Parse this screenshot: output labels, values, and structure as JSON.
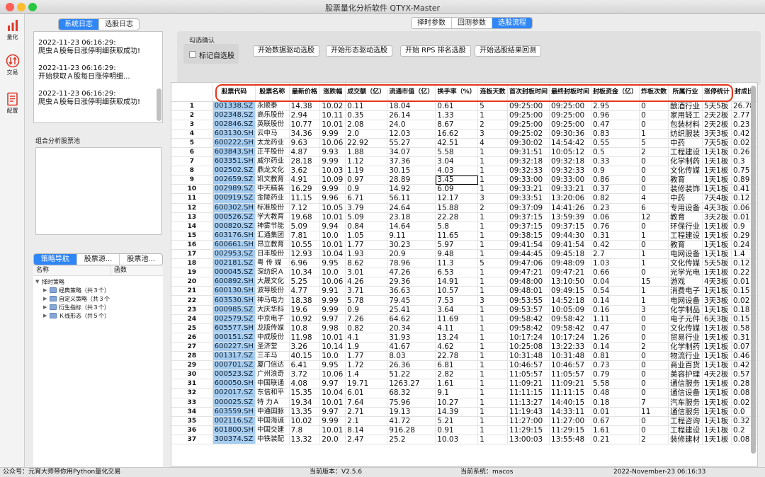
{
  "window": {
    "title": "股票量化分析软件 QTYX-Master",
    "controls": {
      "close": "#fd5f57",
      "minimize": "#febc2e",
      "maximize": "#27c840"
    }
  },
  "leftbar": {
    "items": [
      {
        "label": "量化",
        "icon": "bar-chart-icon",
        "color": "#e03a2a"
      },
      {
        "label": "交易",
        "icon": "trade-exchange-icon",
        "color": "#e03a2a"
      },
      {
        "label": "配置",
        "icon": "document-config-icon",
        "color": "#e03a2a"
      }
    ]
  },
  "log_tabs": [
    {
      "label": "系统日志",
      "active": true
    },
    {
      "label": "选股日志",
      "active": false
    }
  ],
  "log_entries": [
    {
      "time": "2022-11-23 06:16:29:",
      "msg": "爬虫Ａ股每日涨停明细获取成功!"
    },
    {
      "time": "2022-11-23 06:16:29:",
      "msg": "开始获取Ａ股每日涨停明细..."
    },
    {
      "time": "2022-11-23 06:16:29:",
      "msg": "爬虫Ａ股每日涨停明细获取成功!"
    }
  ],
  "pool": {
    "label": "组合分析股票池"
  },
  "nav_tabs": [
    {
      "label": "策略导航",
      "active": true
    },
    {
      "label": "股票源...",
      "active": false
    },
    {
      "label": "股票池...",
      "active": false
    }
  ],
  "tree": {
    "headers": [
      "名称",
      "函数"
    ],
    "root": "择时策略",
    "children": [
      "经典策略（共３个）",
      "自定义策略（共３个",
      "衍生指标（共３个）",
      "Ｋ线形态（共５个）"
    ]
  },
  "top_tabs": [
    {
      "label": "择时参数",
      "active": false
    },
    {
      "label": "回测参数",
      "active": false
    },
    {
      "label": "选股流程",
      "active": true
    }
  ],
  "select_group": {
    "label": "勾选确认",
    "checkbox_label": "标记自选股",
    "buttons": [
      "开始数据驱动选股",
      "开始形态驱动选股",
      "开始 RPS 排名选股",
      "开始选股结果回测"
    ]
  },
  "table": {
    "headers": [
      "股票代码",
      "股票名称",
      "最新价格",
      "涨跌幅",
      "成交额（亿）",
      "流通市值（亿）",
      "换手率（%）",
      "连板天数",
      "首次封板时间",
      "最终封板时间",
      "封板资金（亿）",
      "炸板次数",
      "所属行业",
      "涨停统计",
      "封成比"
    ],
    "rows": [
      [
        "1",
        "001338.SZ",
        "永顺泰",
        "14.38",
        "10.02",
        "0.11",
        "18.04",
        "0.61",
        "5",
        "09:25:00",
        "09:25:00",
        "2.95",
        "0",
        "酿酒行业",
        "5天5板",
        "26.78"
      ],
      [
        "2",
        "002348.SZ",
        "高乐股份",
        "2.94",
        "10.11",
        "0.35",
        "26.14",
        "1.33",
        "1",
        "09:25:00",
        "09:25:00",
        "0.96",
        "0",
        "家用轻工",
        "2天2板",
        "2.77"
      ],
      [
        "3",
        "002846.SZ",
        "英联股份",
        "10.77",
        "10.01",
        "2.08",
        "24.0",
        "8.67",
        "2",
        "09:25:00",
        "09:25:00",
        "0.47",
        "0",
        "包装材料",
        "2天2板",
        "0.23"
      ],
      [
        "4",
        "603130.SH",
        "云中马",
        "34.36",
        "9.99",
        "2.0",
        "12.03",
        "16.62",
        "3",
        "09:25:02",
        "09:30:36",
        "0.83",
        "1",
        "纺织服装",
        "3天3板",
        "0.42"
      ],
      [
        "5",
        "600222.SH",
        "太龙药业",
        "9.63",
        "10.06",
        "22.92",
        "55.27",
        "42.51",
        "4",
        "09:30:02",
        "14:54:42",
        "0.55",
        "5",
        "中药",
        "7天5板",
        "0.02"
      ],
      [
        "6",
        "603843.SH",
        "正平股份",
        "4.87",
        "9.93",
        "1.88",
        "34.07",
        "5.58",
        "1",
        "09:31:51",
        "10:05:12",
        "0.5",
        "2",
        "工程建设",
        "1天1板",
        "0.26"
      ],
      [
        "7",
        "603351.SH",
        "威尔药业",
        "28.18",
        "9.99",
        "1.12",
        "37.36",
        "3.04",
        "1",
        "09:32:18",
        "09:32:18",
        "0.33",
        "0",
        "化学制药",
        "1天1板",
        "0.3"
      ],
      [
        "8",
        "002502.SZ",
        "鼎龙文化",
        "3.62",
        "10.03",
        "1.19",
        "30.15",
        "4.03",
        "1",
        "09:32:33",
        "09:32:33",
        "0.9",
        "0",
        "文化传媒",
        "1天1板",
        "0.75"
      ],
      [
        "9",
        "002659.SZ",
        "凯文教育",
        "4.91",
        "10.09",
        "0.97",
        "28.89",
        "3.45",
        "1",
        "09:33:00",
        "09:33:00",
        "0.86",
        "0",
        "教育",
        "1天1板",
        "0.89"
      ],
      [
        "10",
        "002989.SZ",
        "中天精装",
        "16.29",
        "9.99",
        "0.9",
        "14.92",
        "6.09",
        "1",
        "09:33:21",
        "09:33:21",
        "0.37",
        "0",
        "装修装饰",
        "1天1板",
        "0.41"
      ],
      [
        "11",
        "000919.SZ",
        "金陵药业",
        "11.15",
        "9.96",
        "6.71",
        "56.11",
        "12.17",
        "3",
        "09:33:51",
        "13:20:06",
        "0.82",
        "4",
        "中药",
        "7天4板",
        "0.12"
      ],
      [
        "12",
        "600302.SH",
        "标准股份",
        "7.12",
        "10.05",
        "3.79",
        "24.64",
        "15.88",
        "2",
        "09:37:09",
        "14:41:26",
        "0.23",
        "6",
        "专用设备",
        "4天3板",
        "0.06"
      ],
      [
        "13",
        "000526.SZ",
        "学大教育",
        "19.68",
        "10.01",
        "5.09",
        "23.18",
        "22.28",
        "1",
        "09:37:15",
        "13:59:39",
        "0.06",
        "12",
        "教育",
        "3天2板",
        "0.01"
      ],
      [
        "14",
        "000820.SZ",
        "神雾节能",
        "5.09",
        "9.94",
        "0.84",
        "14.64",
        "5.8",
        "1",
        "09:37:15",
        "09:37:15",
        "0.76",
        "0",
        "环保行业",
        "1天1板",
        "0.9"
      ],
      [
        "15",
        "603176.SH",
        "汇通集团",
        "7.81",
        "10.0",
        "1.05",
        "9.11",
        "11.65",
        "1",
        "09:38:15",
        "09:44:30",
        "0.31",
        "1",
        "工程建设",
        "1天1板",
        "0.29"
      ],
      [
        "16",
        "600661.SH",
        "昂立教育",
        "10.55",
        "10.01",
        "1.77",
        "30.23",
        "5.97",
        "1",
        "09:41:54",
        "09:41:54",
        "0.42",
        "0",
        "教育",
        "1天1板",
        "0.24"
      ],
      [
        "17",
        "002953.SZ",
        "日丰股份",
        "12.93",
        "10.04",
        "1.93",
        "20.9",
        "9.48",
        "1",
        "09:44:45",
        "09:45:18",
        "2.7",
        "1",
        "电网设备",
        "1天1板",
        "1.4"
      ],
      [
        "18",
        "002181.SZ",
        "粤 传 媒",
        "6.96",
        "9.95",
        "8.62",
        "78.96",
        "11.3",
        "5",
        "09:47:06",
        "09:48:09",
        "1.03",
        "1",
        "文化传媒",
        "5天5板",
        "0.12"
      ],
      [
        "19",
        "000045.SZ",
        "深纺织Ａ",
        "10.34",
        "10.0",
        "3.01",
        "47.26",
        "6.53",
        "1",
        "09:47:21",
        "09:47:21",
        "0.66",
        "0",
        "光学光电",
        "1天1板",
        "0.22"
      ],
      [
        "20",
        "600892.SH",
        "大晟文化",
        "5.25",
        "10.06",
        "4.26",
        "29.36",
        "14.91",
        "1",
        "09:48:00",
        "13:10:50",
        "0.04",
        "15",
        "游戏",
        "4天3板",
        "0.01"
      ],
      [
        "21",
        "600130.SH",
        "波导股份",
        "4.77",
        "9.91",
        "3.71",
        "36.63",
        "10.57",
        "1",
        "09:48:01",
        "09:49:15",
        "0.54",
        "1",
        "消费电子",
        "1天1板",
        "0.15"
      ],
      [
        "22",
        "603530.SH",
        "神马电力",
        "18.38",
        "9.99",
        "5.78",
        "79.45",
        "7.53",
        "3",
        "09:53:55",
        "14:52:18",
        "0.14",
        "1",
        "电网设备",
        "3天3板",
        "0.02"
      ],
      [
        "23",
        "000985.SZ",
        "大庆华科",
        "19.6",
        "9.99",
        "0.9",
        "25.41",
        "3.64",
        "1",
        "09:53:57",
        "10:05:09",
        "0.16",
        "3",
        "化学制品",
        "1天1板",
        "0.18"
      ],
      [
        "24",
        "002579.SZ",
        "中京电子",
        "10.92",
        "9.97",
        "7.26",
        "64.62",
        "11.69",
        "1",
        "09:58:42",
        "09:58:42",
        "1.11",
        "0",
        "电子元件",
        "6天3板",
        "0.15"
      ],
      [
        "25",
        "605577.SH",
        "龙版传媒",
        "10.8",
        "9.98",
        "0.82",
        "20.34",
        "4.11",
        "1",
        "09:58:42",
        "09:58:42",
        "0.47",
        "0",
        "文化传媒",
        "1天1板",
        "0.58"
      ],
      [
        "26",
        "000151.SZ",
        "中成股份",
        "11.98",
        "10.01",
        "4.1",
        "31.93",
        "13.24",
        "1",
        "10:17:24",
        "10:17:24",
        "1.26",
        "0",
        "贸易行业",
        "1天1板",
        "0.31"
      ],
      [
        "27",
        "600227.SH",
        "圣济堂",
        "3.26",
        "10.14",
        "1.9",
        "41.67",
        "4.62",
        "1",
        "10:25:08",
        "13:22:33",
        "0.14",
        "2",
        "化学制药",
        "1天1板",
        "0.07"
      ],
      [
        "28",
        "001317.SZ",
        "三羊马",
        "40.15",
        "10.0",
        "1.77",
        "8.03",
        "22.78",
        "1",
        "10:31:48",
        "10:31:48",
        "0.81",
        "0",
        "物流行业",
        "1天1板",
        "0.46"
      ],
      [
        "29",
        "000701.SZ",
        "厦门信达",
        "6.41",
        "9.95",
        "1.72",
        "26.36",
        "6.81",
        "1",
        "10:46:57",
        "10:46:57",
        "0.73",
        "0",
        "商业百货",
        "1天1板",
        "0.42"
      ],
      [
        "30",
        "000523.SZ",
        "广州浪奇",
        "3.72",
        "10.06",
        "1.4",
        "51.22",
        "2.82",
        "1",
        "11:05:57",
        "11:05:57",
        "0.79",
        "0",
        "美容护理",
        "4天2板",
        "0.57"
      ],
      [
        "31",
        "600050.SH",
        "中国联通",
        "4.08",
        "9.97",
        "19.71",
        "1263.27",
        "1.61",
        "1",
        "11:09:21",
        "11:09:21",
        "5.58",
        "0",
        "通信服务",
        "1天1板",
        "0.28"
      ],
      [
        "32",
        "002017.SZ",
        "东信和平",
        "15.35",
        "10.04",
        "6.01",
        "68.32",
        "9.1",
        "1",
        "11:11:15",
        "11:11:15",
        "0.48",
        "0",
        "通信设备",
        "1天1板",
        "0.08"
      ],
      [
        "33",
        "000025.SZ",
        "特 力Ａ",
        "19.34",
        "10.01",
        "7.64",
        "75.96",
        "10.27",
        "1",
        "11:13:27",
        "14:40:15",
        "0.18",
        "7",
        "汽车服务",
        "1天1板",
        "0.02"
      ],
      [
        "34",
        "603559.SH",
        "中通国脉",
        "13.35",
        "9.97",
        "2.71",
        "19.13",
        "14.39",
        "1",
        "11:19:43",
        "14:33:11",
        "0.01",
        "11",
        "通信服务",
        "1天1板",
        "0.0"
      ],
      [
        "35",
        "002116.SZ",
        "中国海诚",
        "10.02",
        "9.99",
        "2.1",
        "41.72",
        "5.21",
        "1",
        "11:27:00",
        "11:27:00",
        "0.67",
        "0",
        "工程咨询",
        "1天1板",
        "0.32"
      ],
      [
        "36",
        "601800.SH",
        "中国交建",
        "7.8",
        "10.01",
        "8.14",
        "916.28",
        "0.91",
        "1",
        "11:29:15",
        "11:29:15",
        "1.61",
        "0",
        "工程建设",
        "1天1板",
        "0.2"
      ],
      [
        "37",
        "300374.SZ",
        "中铁装配",
        "13.32",
        "20.0",
        "2.47",
        "25.2",
        "10.03",
        "1",
        "13:00:03",
        "13:55:48",
        "0.21",
        "2",
        "装修建材",
        "1天1板",
        "0.08"
      ]
    ]
  },
  "status": {
    "left": "公众号：元宵大师带你用Python量化交易",
    "version": "当前版本：V2.5.6",
    "system": "当前系统：macos",
    "datetime": "2022-November-23 06:16:33"
  }
}
